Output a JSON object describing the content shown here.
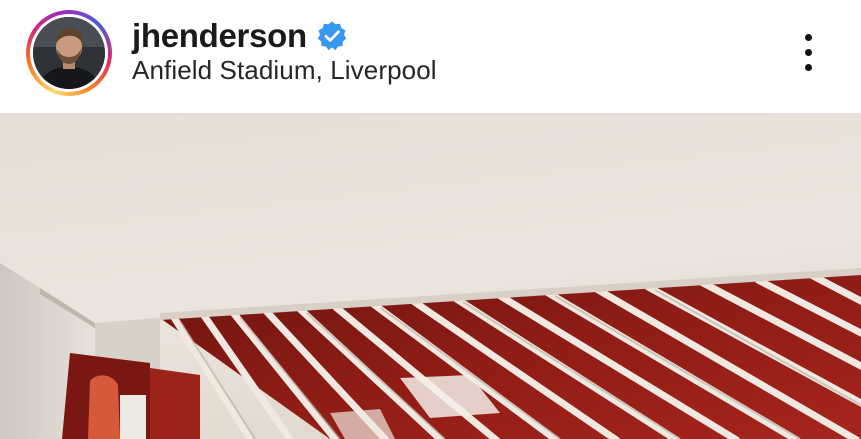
{
  "post": {
    "header": {
      "username": "jhenderson",
      "verified": true,
      "location": "Anfield Stadium, Liverpool"
    },
    "icons": {
      "verified": "verified-badge-icon",
      "more": "more-vertical-icon"
    },
    "colors": {
      "verified_blue": "#3897f0",
      "ceiling": "#e4dbd2",
      "slat_red": "#8a1a14",
      "story_ring": [
        "#feda75",
        "#fa7e1e",
        "#d62976",
        "#962fbf",
        "#4f5bd5"
      ]
    }
  }
}
